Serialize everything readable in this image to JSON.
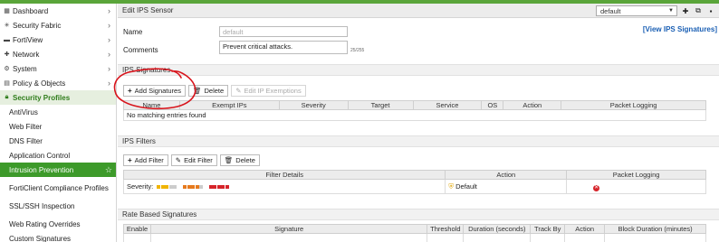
{
  "sidebar": {
    "items": [
      {
        "label": "Dashboard",
        "icon": "dashboard-icon"
      },
      {
        "label": "Security Fabric",
        "icon": "fabric-icon"
      },
      {
        "label": "FortiView",
        "icon": "fortiview-icon"
      },
      {
        "label": "Network",
        "icon": "network-icon"
      },
      {
        "label": "System",
        "icon": "gear-icon"
      },
      {
        "label": "Policy & Objects",
        "icon": "policy-icon"
      }
    ],
    "section": {
      "label": "Security Profiles",
      "icon": "lock-icon"
    },
    "subitems": [
      "AntiVirus",
      "Web Filter",
      "DNS Filter",
      "Application Control",
      "Intrusion Prevention",
      "FortiClient Compliance Profiles",
      "SSL/SSH Inspection",
      "Web Rating Overrides",
      "Custom Signatures"
    ]
  },
  "header": {
    "title": "Edit IPS Sensor",
    "vdom_value": "default"
  },
  "form": {
    "name_label": "Name",
    "name_placeholder": "default",
    "comments_label": "Comments",
    "comments_value": "Prevent critical attacks.",
    "char_count": "25/255",
    "view_link": "[View IPS Signatures]"
  },
  "ips_signatures": {
    "title": "IPS Signatures",
    "buttons": {
      "add": "Add Signatures",
      "delete": "Delete",
      "edit_exemptions": "Edit IP Exemptions"
    },
    "columns": [
      "Name",
      "Exempt IPs",
      "Severity",
      "Target",
      "Service",
      "OS",
      "Action",
      "Packet Logging"
    ],
    "empty_text": "No matching entries found"
  },
  "ips_filters": {
    "title": "IPS Filters",
    "buttons": {
      "add": "Add Filter",
      "edit": "Edit Filter",
      "delete": "Delete"
    },
    "columns": [
      "Filter Details",
      "Action",
      "Packet Logging"
    ],
    "row": {
      "details_label": "Severity:",
      "action": "Default"
    }
  },
  "rate_based": {
    "title": "Rate Based Signatures",
    "columns": [
      "Enable",
      "Signature",
      "Threshold",
      "Duration (seconds)",
      "Track By",
      "Action",
      "Block Duration (minutes)"
    ]
  },
  "colors": {
    "brand_green": "#3d9a2a",
    "annotation_red": "#d8141c",
    "link_blue": "#1a5fb4",
    "delete_red": "#d6242a"
  }
}
